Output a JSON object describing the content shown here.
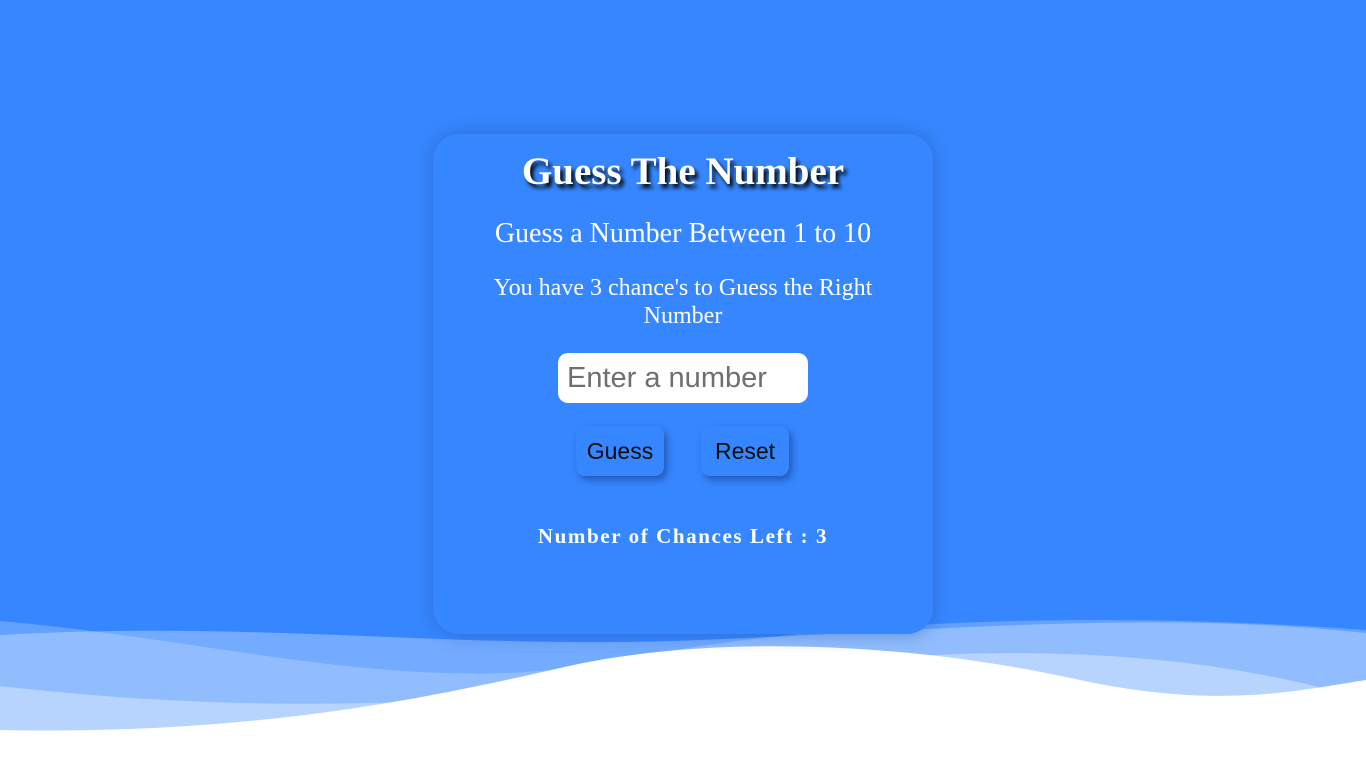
{
  "app": {
    "title": "Guess The Number",
    "instruction": "Guess a Number Between 1 to 10",
    "chances_info": "You have 3 chance's to Guess the Right Number"
  },
  "input": {
    "placeholder": "Enter a number",
    "value": ""
  },
  "buttons": {
    "guess_label": "Guess",
    "reset_label": "Reset"
  },
  "status": {
    "chances_left_text": "Number of Chances Left : 3"
  },
  "colors": {
    "background": "#3687ff",
    "card": "#3687ff",
    "text": "#ffffff"
  }
}
